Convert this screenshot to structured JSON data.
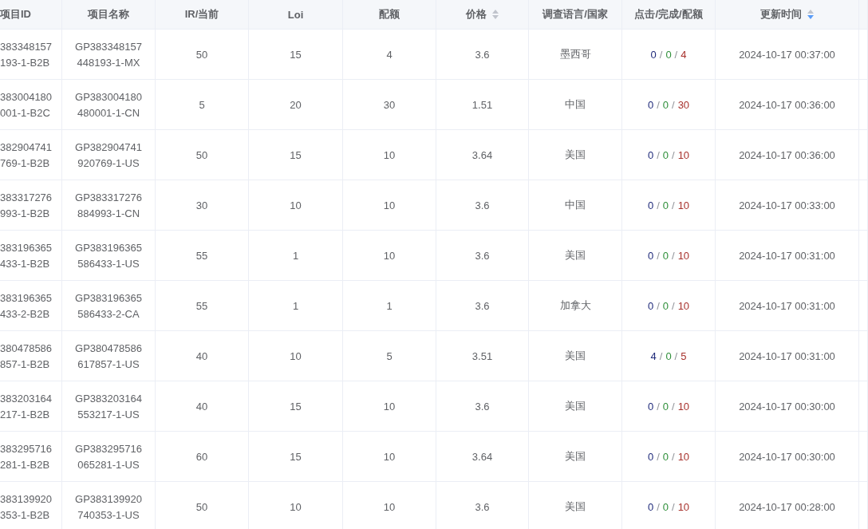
{
  "table": {
    "columns": [
      {
        "label": "项目ID"
      },
      {
        "label": "项目名称"
      },
      {
        "label": "IR/当前"
      },
      {
        "label": "Loi"
      },
      {
        "label": "配额"
      },
      {
        "label": "价格",
        "sortable": true,
        "sorted_desc": false
      },
      {
        "label": "调查语言/国家"
      },
      {
        "label": "点击/完成/配额"
      },
      {
        "label": "更新时间",
        "sortable": true,
        "sorted_desc": true
      }
    ],
    "rows": [
      {
        "id": [
          "383348157",
          "193-1-B2B"
        ],
        "name": [
          "GP383348157",
          "448193-1-MX"
        ],
        "ir": "50",
        "loi": "15",
        "quota": "4",
        "price": "3.6",
        "country": "墨西哥",
        "stats": [
          "0",
          "/",
          "0",
          "/",
          "4"
        ],
        "updated": "2024-10-17 00:37:00"
      },
      {
        "id": [
          "383004180",
          "001-1-B2C"
        ],
        "name": [
          "GP383004180",
          "480001-1-CN"
        ],
        "ir": "5",
        "loi": "20",
        "quota": "30",
        "price": "1.51",
        "country": "中国",
        "stats": [
          "0",
          "/",
          "0",
          "/",
          "30"
        ],
        "updated": "2024-10-17 00:36:00"
      },
      {
        "id": [
          "382904741",
          "769-1-B2B"
        ],
        "name": [
          "GP382904741",
          "920769-1-US"
        ],
        "ir": "50",
        "loi": "15",
        "quota": "10",
        "price": "3.64",
        "country": "美国",
        "stats": [
          "0",
          "/",
          "0",
          "/",
          "10"
        ],
        "updated": "2024-10-17 00:36:00"
      },
      {
        "id": [
          "383317276",
          "993-1-B2B"
        ],
        "name": [
          "GP383317276",
          "884993-1-CN"
        ],
        "ir": "30",
        "loi": "10",
        "quota": "10",
        "price": "3.6",
        "country": "中国",
        "stats": [
          "0",
          "/",
          "0",
          "/",
          "10"
        ],
        "updated": "2024-10-17 00:33:00"
      },
      {
        "id": [
          "383196365",
          "433-1-B2B"
        ],
        "name": [
          "GP383196365",
          "586433-1-US"
        ],
        "ir": "55",
        "loi": "1",
        "quota": "10",
        "price": "3.6",
        "country": "美国",
        "stats": [
          "0",
          "/",
          "0",
          "/",
          "10"
        ],
        "updated": "2024-10-17 00:31:00"
      },
      {
        "id": [
          "383196365",
          "433-2-B2B"
        ],
        "name": [
          "GP383196365",
          "586433-2-CA"
        ],
        "ir": "55",
        "loi": "1",
        "quota": "1",
        "price": "3.6",
        "country": "加拿大",
        "stats": [
          "0",
          "/",
          "0",
          "/",
          "10"
        ],
        "updated": "2024-10-17 00:31:00"
      },
      {
        "id": [
          "380478586",
          "857-1-B2B"
        ],
        "name": [
          "GP380478586",
          "617857-1-US"
        ],
        "ir": "40",
        "loi": "10",
        "quota": "5",
        "price": "3.51",
        "country": "美国",
        "stats": [
          "4",
          "/",
          "0",
          "/",
          "5"
        ],
        "updated": "2024-10-17 00:31:00"
      },
      {
        "id": [
          "383203164",
          "217-1-B2B"
        ],
        "name": [
          "GP383203164",
          "553217-1-US"
        ],
        "ir": "40",
        "loi": "15",
        "quota": "10",
        "price": "3.6",
        "country": "美国",
        "stats": [
          "0",
          "/",
          "0",
          "/",
          "10"
        ],
        "updated": "2024-10-17 00:30:00"
      },
      {
        "id": [
          "383295716",
          "281-1-B2B"
        ],
        "name": [
          "GP383295716",
          "065281-1-US"
        ],
        "ir": "60",
        "loi": "15",
        "quota": "10",
        "price": "3.64",
        "country": "美国",
        "stats": [
          "0",
          "/",
          "0",
          "/",
          "10"
        ],
        "updated": "2024-10-17 00:30:00"
      },
      {
        "id": [
          "383139920",
          "353-1-B2B"
        ],
        "name": [
          "GP383139920",
          "740353-1-US"
        ],
        "ir": "50",
        "loi": "10",
        "quota": "10",
        "price": "3.6",
        "country": "美国",
        "stats": [
          "0",
          "/",
          "0",
          "/",
          "10"
        ],
        "updated": "2024-10-17 00:28:00"
      }
    ]
  }
}
